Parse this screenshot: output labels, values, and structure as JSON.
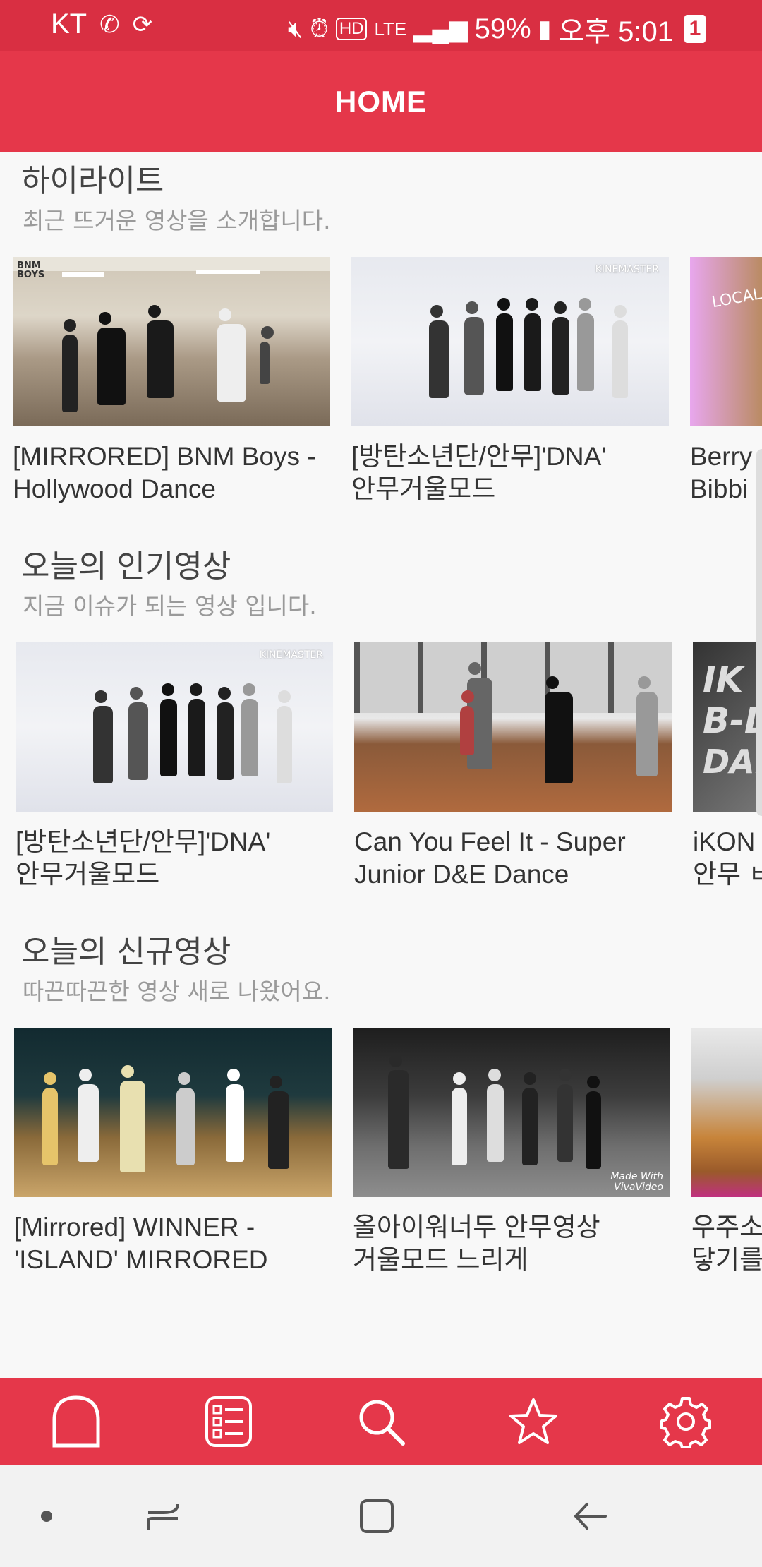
{
  "status_bar": {
    "carrier": "KT",
    "battery": "59%",
    "time": "오후 5:01",
    "notif_count": "1",
    "network": "LTE"
  },
  "appbar": {
    "title": "HOME"
  },
  "sections": [
    {
      "title": "하이라이트",
      "subtitle": "최근 뜨거운 영상을 소개합니다.",
      "cards": [
        {
          "line1": "[MIRRORED] BNM Boys -",
          "line2": "Hollywood Dance"
        },
        {
          "line1": "[방탄소년단/안무]'DNA'",
          "line2": "안무거울모드"
        },
        {
          "line1": "Berry",
          "line2": "Bibbi"
        }
      ]
    },
    {
      "title": "오늘의 인기영상",
      "subtitle": "지금 이슈가 되는 영상 입니다.",
      "cards": [
        {
          "line1": "[방탄소년단/안무]'DNA'",
          "line2": "안무거울모드"
        },
        {
          "line1": "Can You Feel It - Super",
          "line2": "Junior D&E Dance"
        },
        {
          "line1": "iKON",
          "line2": "안무 ㅂ"
        }
      ]
    },
    {
      "title": "오늘의 신규영상",
      "subtitle": "따끈따끈한 영상 새로 나왔어요.",
      "cards": [
        {
          "line1": "[Mirrored] WINNER -",
          "line2": "'ISLAND' MIRRORED"
        },
        {
          "line1": "올아이워너두 안무영상",
          "line2": "거울모드 느리게"
        },
        {
          "line1": "우주소",
          "line2": "닿기를"
        }
      ]
    }
  ],
  "thumb_text": {
    "bnm": "BNM BOYS",
    "kinemaster": "KINEMASTER",
    "ikon_line1": "IK",
    "ikon_line2": "B-D",
    "ikon_line3": "DANCE",
    "vivavideo": "Made With VivaVideo",
    "local": "LOCAL FRIEN"
  },
  "bottom_nav": [
    "home-icon",
    "list-icon",
    "search-icon",
    "star-icon",
    "gear-icon"
  ],
  "colors": {
    "status": "#d92f42",
    "accent": "#e5374a"
  }
}
